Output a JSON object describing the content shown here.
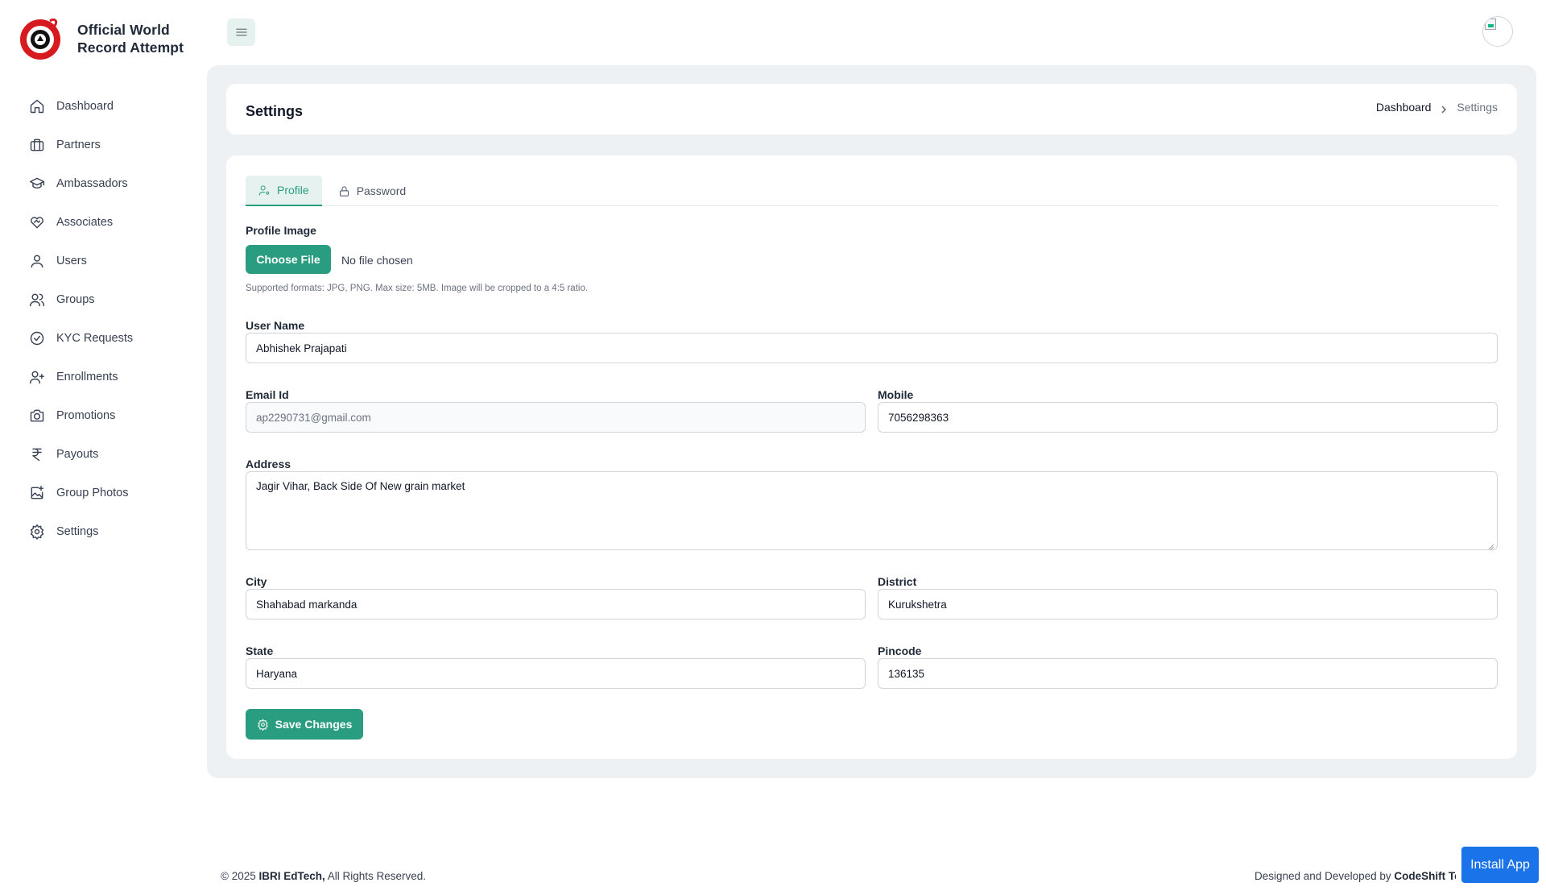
{
  "brand": {
    "line1": "Official World",
    "line2": "Record Attempt"
  },
  "sidebar": {
    "items": [
      {
        "label": "Dashboard",
        "icon": "home-icon"
      },
      {
        "label": "Partners",
        "icon": "briefcase-icon"
      },
      {
        "label": "Ambassadors",
        "icon": "graduation-cap-icon"
      },
      {
        "label": "Associates",
        "icon": "heart-handshake-icon"
      },
      {
        "label": "Users",
        "icon": "user-icon"
      },
      {
        "label": "Groups",
        "icon": "users-icon"
      },
      {
        "label": "KYC Requests",
        "icon": "check-circle-icon"
      },
      {
        "label": "Enrollments",
        "icon": "user-plus-icon"
      },
      {
        "label": "Promotions",
        "icon": "camera-icon"
      },
      {
        "label": "Payouts",
        "icon": "rupee-icon"
      },
      {
        "label": "Group Photos",
        "icon": "image-plus-icon"
      },
      {
        "label": "Settings",
        "icon": "gear-icon"
      }
    ]
  },
  "header": {
    "title": "Settings",
    "breadcrumb_home": "Dashboard",
    "breadcrumb_current": "Settings"
  },
  "tabs": {
    "profile": "Profile",
    "password": "Password"
  },
  "form": {
    "profile_image_label": "Profile Image",
    "choose_file": "Choose File",
    "no_file": "No file chosen",
    "help_text": "Supported formats: JPG, PNG. Max size: 5MB. Image will be cropped to a 4:5 ratio.",
    "user_name_label": "User Name",
    "user_name": "Abhishek Prajapati",
    "email_label": "Email Id",
    "email": "ap2290731@gmail.com",
    "mobile_label": "Mobile",
    "mobile": "7056298363",
    "address_label": "Address",
    "address": "Jagir Vihar, Back Side Of New grain market",
    "city_label": "City",
    "city": "Shahabad markanda",
    "district_label": "District",
    "district": "Kurukshetra",
    "state_label": "State",
    "state": "Haryana",
    "pincode_label": "Pincode",
    "pincode": "136135",
    "save_label": "Save Changes"
  },
  "footer": {
    "copyright_prefix": "© 2025 ",
    "company": "IBRI EdTech,",
    "rights": " All Rights Reserved.",
    "designed_by": "Designed and Developed by ",
    "developer": "CodeShift Technologies"
  },
  "install_app": "Install App",
  "colors": {
    "accent": "#2a9d80",
    "accent_light": "#e5f2ef",
    "install": "#1a73e8",
    "logo_red": "#d71920"
  }
}
